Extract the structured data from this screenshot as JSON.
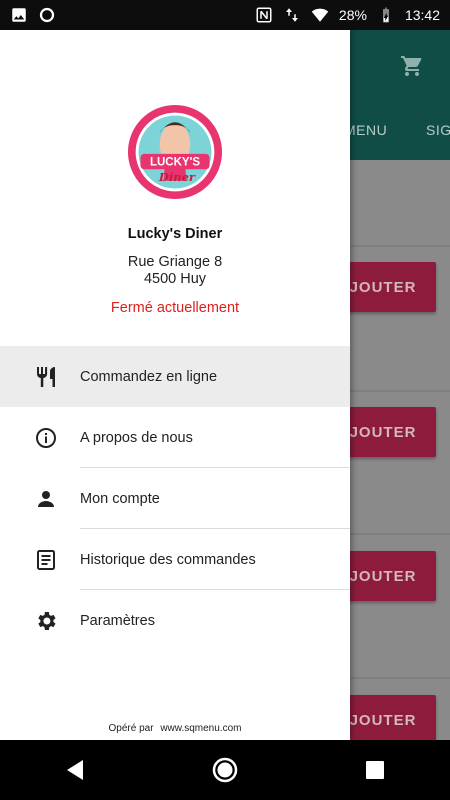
{
  "status_bar": {
    "battery": "28%",
    "time": "13:42",
    "icons": [
      "image-icon",
      "circle-icon",
      "nfc-icon",
      "data-arrows-icon",
      "wifi-icon",
      "battery-charging-icon"
    ]
  },
  "background": {
    "tabs": [
      "MENU",
      "SIG"
    ],
    "button_label": "JOUTER",
    "cart_icon": "cart-icon"
  },
  "drawer": {
    "restaurant_name": "Lucky's Diner",
    "address_line1": "Rue Griange 8",
    "address_line2": "4500 Huy",
    "status": "Fermé actuellement",
    "status_color": "#e0201d",
    "menu": [
      {
        "label": "Commandez en ligne",
        "icon": "restaurant-icon",
        "active": true
      },
      {
        "label": "A propos de nous",
        "icon": "info-icon",
        "active": false
      },
      {
        "label": "Mon compte",
        "icon": "person-icon",
        "active": false
      },
      {
        "label": "Historique des commandes",
        "icon": "receipt-icon",
        "active": false
      },
      {
        "label": "Paramètres",
        "icon": "settings-icon",
        "active": false
      }
    ],
    "footer_prefix": "Opéré par",
    "footer_link": "www.sqmenu.com"
  },
  "logo": {
    "text_top": "LUCKY'S",
    "text_bottom": "Diner"
  },
  "colors": {
    "accent_header": "#0f4d46",
    "button": "#d81b60"
  }
}
